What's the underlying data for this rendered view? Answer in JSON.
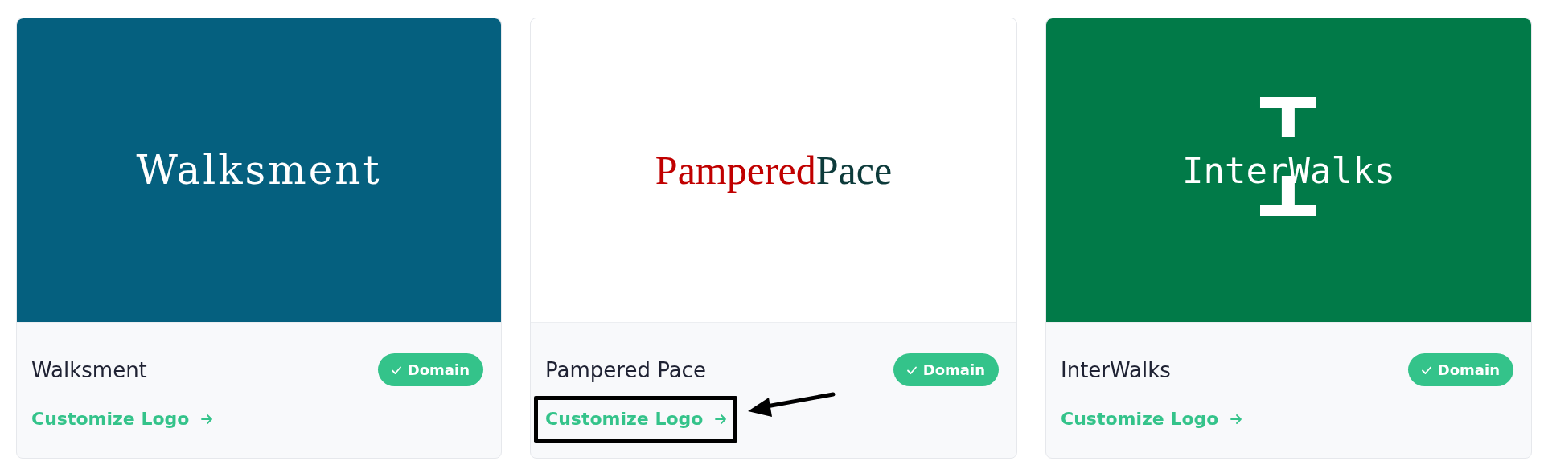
{
  "cards": [
    {
      "logo": {
        "kind": "slab",
        "color": "#05607f",
        "parts": [
          {
            "text": "Walksment",
            "color": "#ffffff"
          }
        ]
      },
      "name": "Walksment",
      "badge": "Domain",
      "link": "Customize Logo",
      "annotated": false
    },
    {
      "logo": {
        "kind": "serif",
        "color": "#ffffff",
        "parts": [
          {
            "text": "Pampered",
            "color": "#c00000"
          },
          {
            "text": "Pace",
            "color": "#0d3b3b"
          }
        ]
      },
      "name": "Pampered Pace",
      "badge": "Domain",
      "link": "Customize Logo",
      "annotated": true
    },
    {
      "logo": {
        "kind": "mono",
        "color": "#017a48",
        "parts": [
          {
            "text": "InterWalks",
            "color": "#ffffff"
          }
        ]
      },
      "name": "InterWalks",
      "badge": "Domain",
      "link": "Customize Logo",
      "annotated": false
    }
  ]
}
